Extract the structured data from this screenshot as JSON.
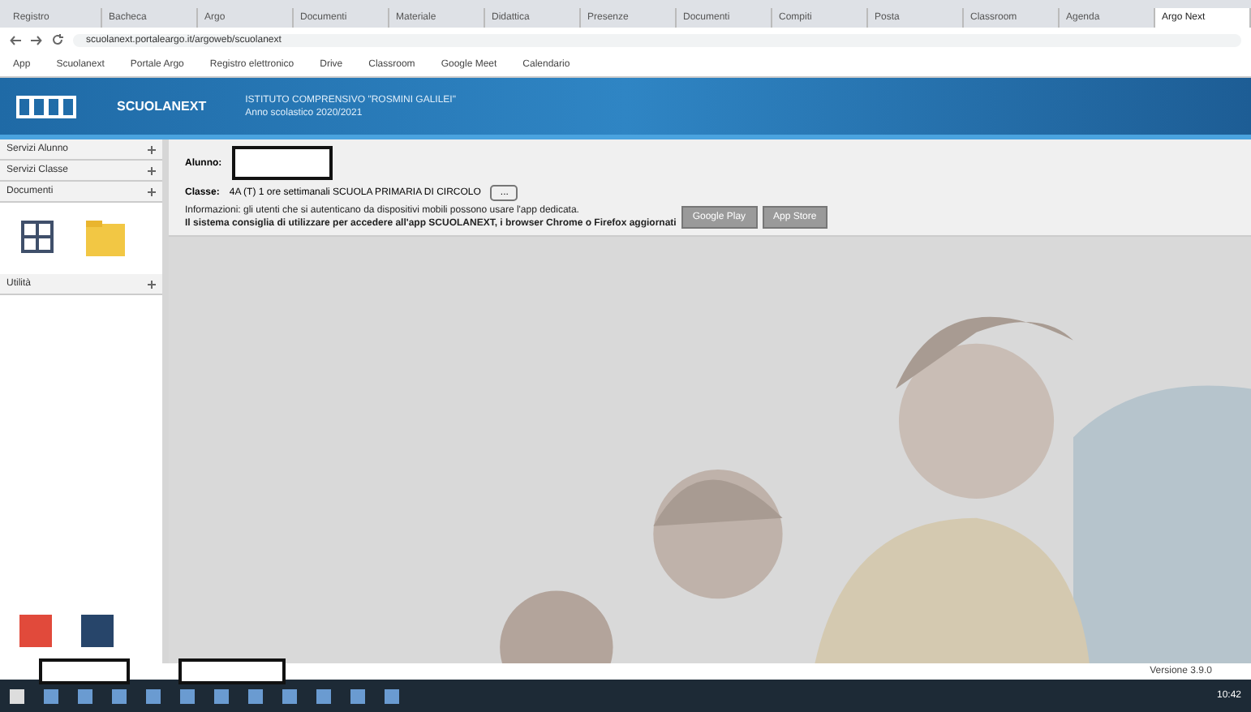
{
  "browser": {
    "tabs": [
      {
        "label": "Registro",
        "selected": false
      },
      {
        "label": "Bacheca",
        "selected": false
      },
      {
        "label": "Argo",
        "selected": false
      },
      {
        "label": "Documenti",
        "selected": false
      },
      {
        "label": "Materiale",
        "selected": false
      },
      {
        "label": "Didattica",
        "selected": false
      },
      {
        "label": "Presenze",
        "selected": false
      },
      {
        "label": "Documenti",
        "selected": false
      },
      {
        "label": "Compiti",
        "selected": false
      },
      {
        "label": "Posta",
        "selected": false
      },
      {
        "label": "Classroom",
        "selected": false
      },
      {
        "label": "Agenda",
        "selected": false
      },
      {
        "label": "Argo Next",
        "selected": true
      }
    ],
    "address": "scuolanext.portaleargo.it/argoweb/scuolanext",
    "bookmarks": [
      "App",
      "Scuolanext",
      "Portale Argo",
      "Registro elettronico",
      "Drive",
      "Classroom",
      "Google Meet",
      "Calendario"
    ]
  },
  "header": {
    "app_name": "SCUOLANEXT",
    "school": "ISTITUTO COMPRENSIVO \"ROSMINI GALILEI\"",
    "subtitle": "Anno scolastico 2020/2021"
  },
  "sidebar": {
    "sections": [
      {
        "label": "Servizi Alunno"
      },
      {
        "label": "Servizi Classe"
      },
      {
        "label": "Documenti"
      }
    ],
    "lower_section": "Utilità"
  },
  "content": {
    "student_label": "Alunno:",
    "class_label": "Classe:",
    "class_value": "4A (T) 1 ore settimanali SCUOLA PRIMARIA DI CIRCOLO",
    "class_button": "...",
    "info": "Informazioni: gli utenti che si autenticano da dispositivi mobili possono usare l'app dedicata.",
    "warning": "Il sistema consiglia di utilizzare per accedere all'app SCUOLANEXT, i browser Chrome o Firefox aggiornati",
    "buttons": [
      "Google Play",
      "App Store"
    ]
  },
  "status_bar": {
    "version": "Versione 3.9.0"
  },
  "taskbar": {
    "time": "10:42"
  }
}
